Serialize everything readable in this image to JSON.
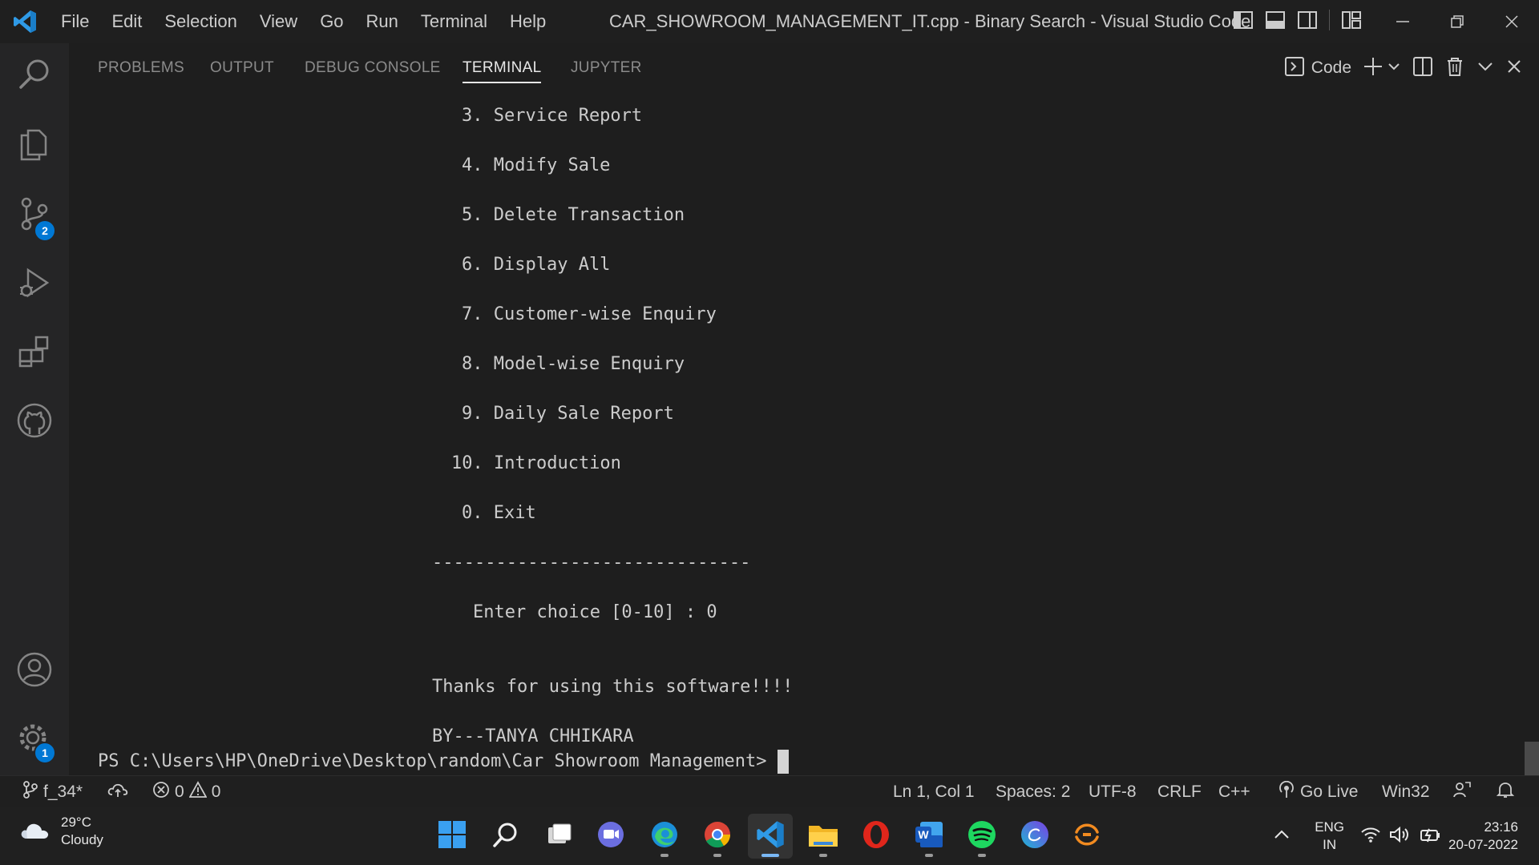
{
  "titlebar": {
    "menu": [
      "File",
      "Edit",
      "Selection",
      "View",
      "Go",
      "Run",
      "Terminal",
      "Help"
    ],
    "title": "CAR_SHOWROOM_MANAGEMENT_IT.cpp - Binary Search - Visual Studio Code",
    "logo_icon": "vscode-logo-icon",
    "layout_icons": [
      "toggle-primary-sidebar-icon",
      "toggle-panel-icon",
      "toggle-secondary-sidebar-icon",
      "customize-layout-icon"
    ],
    "window_controls": [
      "minimize-icon",
      "restore-icon",
      "close-icon"
    ]
  },
  "activitybar": {
    "items": [
      {
        "name": "search",
        "icon": "search-icon"
      },
      {
        "name": "explorer",
        "icon": "files-icon"
      },
      {
        "name": "source-control",
        "icon": "source-control-icon",
        "badge": "2"
      },
      {
        "name": "run-debug",
        "icon": "run-debug-icon"
      },
      {
        "name": "extensions",
        "icon": "extensions-icon"
      },
      {
        "name": "github",
        "icon": "github-icon"
      }
    ],
    "bottom": [
      {
        "name": "accounts",
        "icon": "account-icon"
      },
      {
        "name": "manage",
        "icon": "gear-icon",
        "badge": "1"
      }
    ]
  },
  "panel": {
    "tabs": [
      "PROBLEMS",
      "OUTPUT",
      "DEBUG CONSOLE",
      "TERMINAL",
      "JUPYTER"
    ],
    "active_tab": "TERMINAL",
    "terminal_name": "Code",
    "actions": [
      "terminal-icon",
      "new-terminal-icon",
      "chevron-down-icon",
      "split-terminal-icon",
      "trash-icon",
      "maximize-chevron-icon",
      "close-icon"
    ]
  },
  "terminal": {
    "lines": [
      "3. Service Report",
      "4. Modify Sale",
      "5. Delete Transaction",
      "6. Display All",
      "7. Customer-wise Enquiry",
      "8. Model-wise Enquiry",
      "9. Daily Sale Report",
      "10. Introduction",
      "0. Exit",
      "------------------------------",
      "Enter choice [0-10] : 0",
      "Thanks for using this software!!!!",
      "BY---TANYA CHHIKARA"
    ],
    "prompt": "PS C:\\Users\\HP\\OneDrive\\Desktop\\random\\Car Showroom Management>"
  },
  "statusbar": {
    "branch": "f_34*",
    "errors": "0",
    "warnings": "0",
    "position": "Ln 1, Col 1",
    "spaces": "Spaces: 2",
    "encoding": "UTF-8",
    "eol": "CRLF",
    "language": "C++",
    "golive": "Go Live",
    "platform": "Win32"
  },
  "taskbar": {
    "weather_temp": "29°C",
    "weather_desc": "Cloudy",
    "apps": [
      "start-icon",
      "search-icon",
      "task-view-icon",
      "chat-icon",
      "edge-icon",
      "chrome-icon",
      "vscode-icon",
      "file-explorer-icon",
      "opera-icon",
      "word-icon",
      "spotify-icon",
      "canva-icon",
      "app-icon"
    ],
    "lang_top": "ENG",
    "lang_bottom": "IN",
    "time": "23:16",
    "date": "20-07-2022",
    "colors": {
      "vscode_blue": "#0078d4",
      "badge": "#0078d4",
      "opera": "#e0261b",
      "spotify": "#1ed760",
      "canva": "#19b8c8",
      "word": "#185abd"
    }
  }
}
